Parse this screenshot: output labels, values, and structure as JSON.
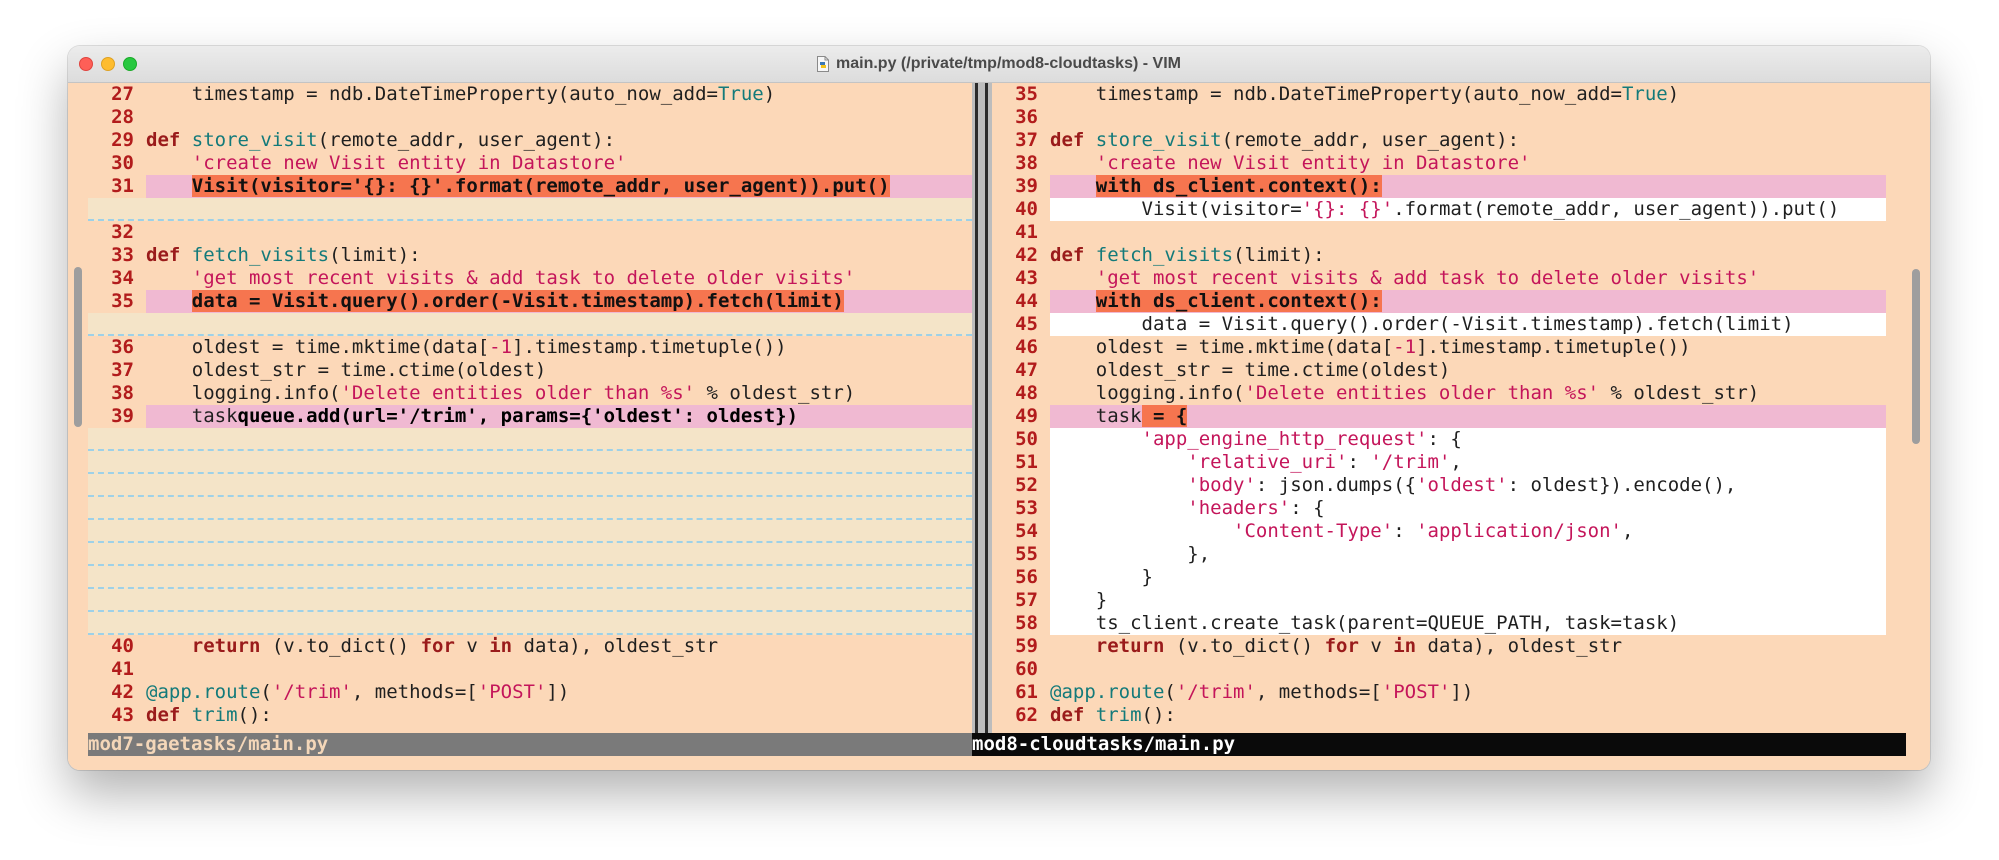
{
  "window": {
    "title": "main.py (/private/tmp/mod8-cloudtasks) - VIM"
  },
  "left_pane": {
    "filename": "mod7-gaetasks/main.py",
    "lines": [
      {
        "type": "line",
        "n": "27",
        "hl": "",
        "segs": [
          [
            "",
            "    timestamp = ndb.DateTimeProperty(auto_now_add="
          ],
          [
            "bi",
            "True"
          ],
          [
            "",
            ")"
          ]
        ]
      },
      {
        "type": "line",
        "n": "28",
        "hl": "",
        "segs": []
      },
      {
        "type": "line",
        "n": "29",
        "hl": "",
        "segs": [
          [
            "kw",
            "def"
          ],
          [
            "",
            " "
          ],
          [
            "fn",
            "store_visit"
          ],
          [
            "",
            "(remote_addr, user_agent):"
          ]
        ]
      },
      {
        "type": "line",
        "n": "30",
        "hl": "",
        "segs": [
          [
            "",
            "    "
          ],
          [
            "cm",
            "'create new Visit entity in Datastore'"
          ]
        ]
      },
      {
        "type": "line",
        "n": "31",
        "hl": "pink",
        "segs": [
          [
            "",
            "    "
          ],
          [
            "chg",
            "Visit(visitor="
          ],
          [
            "chg str",
            "'{}: {}'"
          ],
          [
            "chg",
            ".format(remote_addr, user_agent)).put()"
          ]
        ]
      },
      {
        "type": "filler"
      },
      {
        "type": "line",
        "n": "32",
        "hl": "",
        "segs": []
      },
      {
        "type": "line",
        "n": "33",
        "hl": "",
        "segs": [
          [
            "kw",
            "def"
          ],
          [
            "",
            " "
          ],
          [
            "fn",
            "fetch_visits"
          ],
          [
            "",
            "(limit):"
          ]
        ]
      },
      {
        "type": "line",
        "n": "34",
        "hl": "",
        "segs": [
          [
            "",
            "    "
          ],
          [
            "cm",
            "'get most recent visits & add task to delete older visits'"
          ]
        ]
      },
      {
        "type": "line",
        "n": "35",
        "hl": "pink",
        "segs": [
          [
            "",
            "    "
          ],
          [
            "chg",
            "data = Visit.query().order(-Visit.timestamp).fetch(limit)"
          ]
        ]
      },
      {
        "type": "filler"
      },
      {
        "type": "line",
        "n": "36",
        "hl": "",
        "segs": [
          [
            "",
            "    oldest = time.mktime(data["
          ],
          [
            "num",
            "-1"
          ],
          [
            "",
            "].timestamp.timetuple())"
          ]
        ]
      },
      {
        "type": "line",
        "n": "37",
        "hl": "",
        "segs": [
          [
            "",
            "    oldest_str = time.ctime(oldest)"
          ]
        ]
      },
      {
        "type": "line",
        "n": "38",
        "hl": "",
        "segs": [
          [
            "",
            "    logging.info("
          ],
          [
            "str",
            "'Delete entities older than %s'"
          ],
          [
            "",
            " % oldest_str)"
          ]
        ]
      },
      {
        "type": "line",
        "n": "39",
        "hl": "pink",
        "segs": [
          [
            "",
            "    task"
          ],
          [
            "dk",
            "queue.add(url="
          ],
          [
            "dk str",
            "'/trim'"
          ],
          [
            "dk",
            ", params={"
          ],
          [
            "dk str",
            "'oldest'"
          ],
          [
            "dk",
            ": oldest})"
          ]
        ]
      },
      {
        "type": "filler"
      },
      {
        "type": "filler"
      },
      {
        "type": "filler"
      },
      {
        "type": "filler"
      },
      {
        "type": "filler"
      },
      {
        "type": "filler"
      },
      {
        "type": "filler"
      },
      {
        "type": "filler"
      },
      {
        "type": "filler"
      },
      {
        "type": "line",
        "n": "40",
        "hl": "",
        "segs": [
          [
            "",
            "    "
          ],
          [
            "kw",
            "return"
          ],
          [
            "",
            " (v.to_dict() "
          ],
          [
            "kw",
            "for"
          ],
          [
            "",
            " v "
          ],
          [
            "kw",
            "in"
          ],
          [
            "",
            " data), oldest_str"
          ]
        ]
      },
      {
        "type": "line",
        "n": "41",
        "hl": "",
        "segs": []
      },
      {
        "type": "line",
        "n": "42",
        "hl": "",
        "segs": [
          [
            "fn",
            "@app.route"
          ],
          [
            "",
            "("
          ],
          [
            "str",
            "'/trim'"
          ],
          [
            "",
            ", methods=["
          ],
          [
            "str",
            "'POST'"
          ],
          [
            "",
            "])"
          ]
        ]
      },
      {
        "type": "line",
        "n": "43",
        "hl": "",
        "segs": [
          [
            "kw",
            "def"
          ],
          [
            "",
            " "
          ],
          [
            "fn",
            "trim"
          ],
          [
            "",
            "():"
          ]
        ]
      }
    ]
  },
  "right_pane": {
    "filename": "mod8-cloudtasks/main.py",
    "lines": [
      {
        "type": "line",
        "n": "35",
        "hl": "",
        "segs": [
          [
            "",
            "    timestamp = ndb.DateTimeProperty(auto_now_add="
          ],
          [
            "bi",
            "True"
          ],
          [
            "",
            ")"
          ]
        ]
      },
      {
        "type": "line",
        "n": "36",
        "hl": "",
        "segs": []
      },
      {
        "type": "line",
        "n": "37",
        "hl": "",
        "segs": [
          [
            "kw",
            "def"
          ],
          [
            "",
            " "
          ],
          [
            "fn",
            "store_visit"
          ],
          [
            "",
            "(remote_addr, user_agent):"
          ]
        ]
      },
      {
        "type": "line",
        "n": "38",
        "hl": "",
        "segs": [
          [
            "",
            "    "
          ],
          [
            "cm",
            "'create new Visit entity in Datastore'"
          ]
        ]
      },
      {
        "type": "line",
        "n": "39",
        "hl": "pink",
        "segs": [
          [
            "",
            "    "
          ],
          [
            "chg",
            "with ds_client.context():"
          ]
        ]
      },
      {
        "type": "line",
        "n": "40",
        "hl": "white",
        "segs": [
          [
            "",
            "        Visit(visitor="
          ],
          [
            "str",
            "'{}: {}'"
          ],
          [
            "",
            ".format(remote_addr, user_agent)).put()"
          ]
        ]
      },
      {
        "type": "line",
        "n": "41",
        "hl": "",
        "segs": []
      },
      {
        "type": "line",
        "n": "42",
        "hl": "",
        "segs": [
          [
            "kw",
            "def"
          ],
          [
            "",
            " "
          ],
          [
            "fn",
            "fetch_visits"
          ],
          [
            "",
            "(limit):"
          ]
        ]
      },
      {
        "type": "line",
        "n": "43",
        "hl": "",
        "segs": [
          [
            "",
            "    "
          ],
          [
            "cm",
            "'get most recent visits & add task to delete older visits'"
          ]
        ]
      },
      {
        "type": "line",
        "n": "44",
        "hl": "pink",
        "segs": [
          [
            "",
            "    "
          ],
          [
            "chg",
            "with ds_client.context():"
          ]
        ]
      },
      {
        "type": "line",
        "n": "45",
        "hl": "white",
        "segs": [
          [
            "",
            "        data = Visit.query().order(-Visit.timestamp).fetch(limit)"
          ]
        ]
      },
      {
        "type": "line",
        "n": "46",
        "hl": "",
        "segs": [
          [
            "",
            "    oldest = time.mktime(data["
          ],
          [
            "num",
            "-1"
          ],
          [
            "",
            "].timestamp.timetuple())"
          ]
        ]
      },
      {
        "type": "line",
        "n": "47",
        "hl": "",
        "segs": [
          [
            "",
            "    oldest_str = time.ctime(oldest)"
          ]
        ]
      },
      {
        "type": "line",
        "n": "48",
        "hl": "",
        "segs": [
          [
            "",
            "    logging.info("
          ],
          [
            "str",
            "'Delete entities older than %s'"
          ],
          [
            "",
            " % oldest_str)"
          ]
        ]
      },
      {
        "type": "line",
        "n": "49",
        "hl": "pink",
        "segs": [
          [
            "",
            "    task"
          ],
          [
            "chg",
            " = {"
          ]
        ]
      },
      {
        "type": "line",
        "n": "50",
        "hl": "white",
        "segs": [
          [
            "",
            "        "
          ],
          [
            "str",
            "'app_engine_http_request'"
          ],
          [
            "",
            ": {"
          ]
        ]
      },
      {
        "type": "line",
        "n": "51",
        "hl": "white",
        "segs": [
          [
            "",
            "            "
          ],
          [
            "str",
            "'relative_uri'"
          ],
          [
            "",
            ": "
          ],
          [
            "str",
            "'/trim'"
          ],
          [
            "",
            ","
          ]
        ]
      },
      {
        "type": "line",
        "n": "52",
        "hl": "white",
        "segs": [
          [
            "",
            "            "
          ],
          [
            "str",
            "'body'"
          ],
          [
            "",
            ": json.dumps({"
          ],
          [
            "str",
            "'oldest'"
          ],
          [
            "",
            ": oldest}).encode(),"
          ]
        ]
      },
      {
        "type": "line",
        "n": "53",
        "hl": "white",
        "segs": [
          [
            "",
            "            "
          ],
          [
            "str",
            "'headers'"
          ],
          [
            "",
            ": {"
          ]
        ]
      },
      {
        "type": "line",
        "n": "54",
        "hl": "white",
        "segs": [
          [
            "",
            "                "
          ],
          [
            "str",
            "'Content-Type'"
          ],
          [
            "",
            ": "
          ],
          [
            "str",
            "'application/json'"
          ],
          [
            "",
            ","
          ]
        ]
      },
      {
        "type": "line",
        "n": "55",
        "hl": "white",
        "segs": [
          [
            "",
            "            },"
          ]
        ]
      },
      {
        "type": "line",
        "n": "56",
        "hl": "white",
        "segs": [
          [
            "",
            "        }"
          ]
        ]
      },
      {
        "type": "line",
        "n": "57",
        "hl": "white",
        "segs": [
          [
            "",
            "    }"
          ]
        ]
      },
      {
        "type": "line",
        "n": "58",
        "hl": "white",
        "segs": [
          [
            "",
            "    ts_client.create_task(parent=QUEUE_PATH, task=task)"
          ]
        ]
      },
      {
        "type": "line",
        "n": "59",
        "hl": "",
        "segs": [
          [
            "",
            "    "
          ],
          [
            "kw",
            "return"
          ],
          [
            "",
            " (v.to_dict() "
          ],
          [
            "kw",
            "for"
          ],
          [
            "",
            " v "
          ],
          [
            "kw",
            "in"
          ],
          [
            "",
            " data), oldest_str"
          ]
        ]
      },
      {
        "type": "line",
        "n": "60",
        "hl": "",
        "segs": []
      },
      {
        "type": "line",
        "n": "61",
        "hl": "",
        "segs": [
          [
            "fn",
            "@app.route"
          ],
          [
            "",
            "("
          ],
          [
            "str",
            "'/trim'"
          ],
          [
            "",
            ", methods=["
          ],
          [
            "str",
            "'POST'"
          ],
          [
            "",
            "])"
          ]
        ]
      },
      {
        "type": "line",
        "n": "62",
        "hl": "",
        "segs": [
          [
            "kw",
            "def"
          ],
          [
            "",
            " "
          ],
          [
            "fn",
            "trim"
          ],
          [
            "",
            "():"
          ]
        ]
      }
    ]
  },
  "colors": {
    "background": "#fcd8b8",
    "diff_change_line": "#f0b9d2",
    "diff_change_text": "#f6754f",
    "diff_add": "#ffffff",
    "filler": "#f4e4c8",
    "line_number": "#b21c1c"
  }
}
